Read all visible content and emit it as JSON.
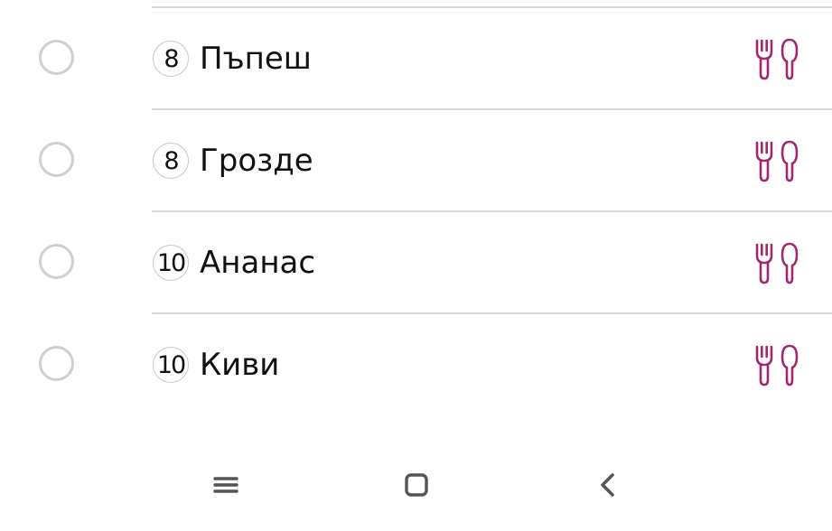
{
  "items": [
    {
      "qty": "8",
      "name": "Пъпеш",
      "icon": "fork-spoon-icon"
    },
    {
      "qty": "8",
      "name": "Грозде",
      "icon": "fork-spoon-icon"
    },
    {
      "qty": "10",
      "name": "Ананас",
      "icon": "fork-spoon-icon"
    },
    {
      "qty": "10",
      "name": "Киви",
      "icon": "fork-spoon-icon"
    }
  ],
  "colors": {
    "accent": "#a3276d",
    "radio_border": "#cfcfcf",
    "divider": "#d9d9d9",
    "text": "#111111",
    "nav_icon": "#555555"
  },
  "navbar": {
    "recents_icon": "menu-lines-icon",
    "home_icon": "home-square-icon",
    "back_icon": "back-chevron-icon"
  }
}
